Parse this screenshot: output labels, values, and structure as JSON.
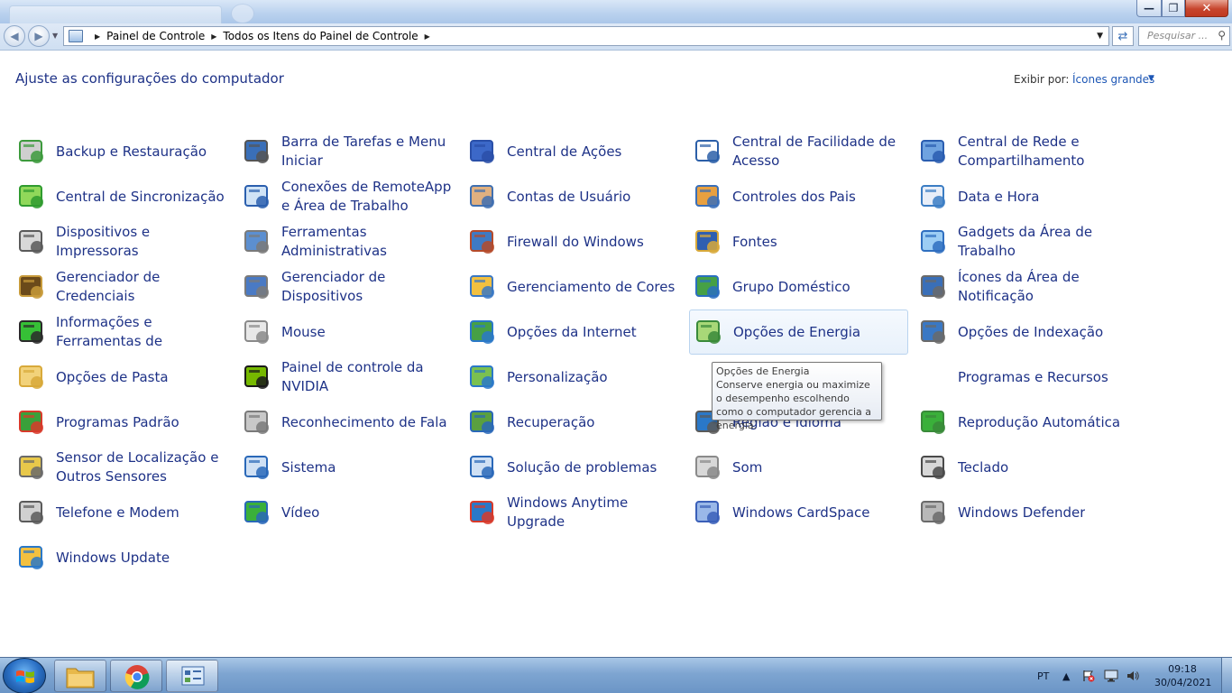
{
  "window": {
    "minimize_icon": "minimize-icon",
    "maximize_icon": "maximize-icon",
    "close_icon": "close-icon"
  },
  "address_bar": {
    "crumbs": [
      "Painel de Controle",
      "Todos os Itens do Painel de Controle"
    ],
    "search_placeholder": "Pesquisar ..."
  },
  "page": {
    "heading": "Ajuste as configurações do computador",
    "view_by_label": "Exibir por:",
    "view_by_value": "Ícones grandes"
  },
  "items": [
    "Backup e Restauração",
    "Barra de Tarefas e Menu Iniciar",
    "Central de Ações",
    "Central de Facilidade de Acesso",
    "Central de Rede e Compartilhamento",
    "Central de Sincronização",
    "Conexões de RemoteApp e Área de Trabalho",
    "Contas de Usuário",
    "Controles dos Pais",
    "Data e Hora",
    "Dispositivos e Impressoras",
    "Ferramentas Administrativas",
    "Firewall do Windows",
    "Fontes",
    "Gadgets da Área de Trabalho",
    "Gerenciador de Credenciais",
    "Gerenciador de Dispositivos",
    "Gerenciamento de Cores",
    "Grupo Doméstico",
    "Ícones da Área de Notificação",
    "Informações e Ferramentas de Desempenho",
    "Mouse",
    "Opções da Internet",
    "Opções de Energia",
    "Opções de Indexação",
    "Opções de Pasta",
    "Painel de controle da NVIDIA",
    "Personalização",
    "Programas e Recursos",
    "Programas e Recursos",
    "Programas Padrão",
    "Reconhecimento de Fala",
    "Recuperação",
    "Região e Idioma",
    "Reprodução Automática",
    "Sensor de Localização e Outros Sensores",
    "Sistema",
    "Solução de problemas",
    "Som",
    "Teclado",
    "Telefone e Modem",
    "Vídeo",
    "Windows Anytime Upgrade",
    "Windows CardSpace",
    "Windows Defender",
    "Windows Update"
  ],
  "tooltip": {
    "title": "Opções de Energia",
    "body": "Conserve energia ou maximize o desempenho escolhendo como o computador gerencia a energia."
  },
  "taskbar": {
    "language": "PT",
    "time": "09:18",
    "date": "30/04/2021"
  },
  "colors": {
    "link": "#1e3287",
    "accent": "#1e57b5"
  }
}
